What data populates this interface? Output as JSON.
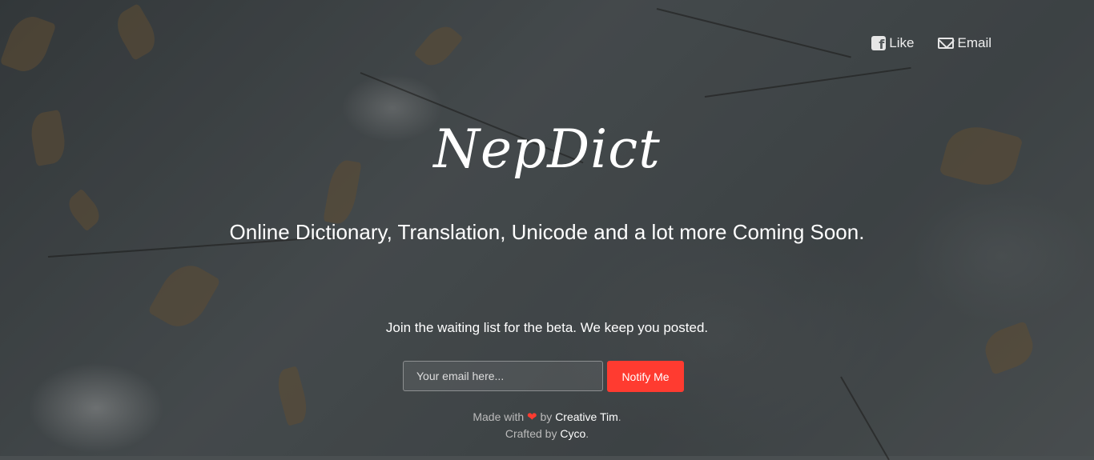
{
  "nav": {
    "like_label": "Like",
    "email_label": "Email"
  },
  "hero": {
    "logo": "NepDict",
    "tagline": "Online Dictionary, Translation, Unicode and a lot more Coming Soon."
  },
  "signup": {
    "intro": "Join the waiting list for the beta. We keep you posted.",
    "email_placeholder": "Your email here...",
    "button_label": "Notify Me"
  },
  "footer": {
    "made_with": "Made with",
    "by": "by",
    "author": "Creative Tim",
    "period1": ".",
    "crafted_by": "Crafted by",
    "crafter": "Cyco",
    "period2": "."
  },
  "colors": {
    "accent": "#ff3b30"
  },
  "icons": [
    "facebook-icon",
    "mail-icon",
    "heart-icon"
  ]
}
